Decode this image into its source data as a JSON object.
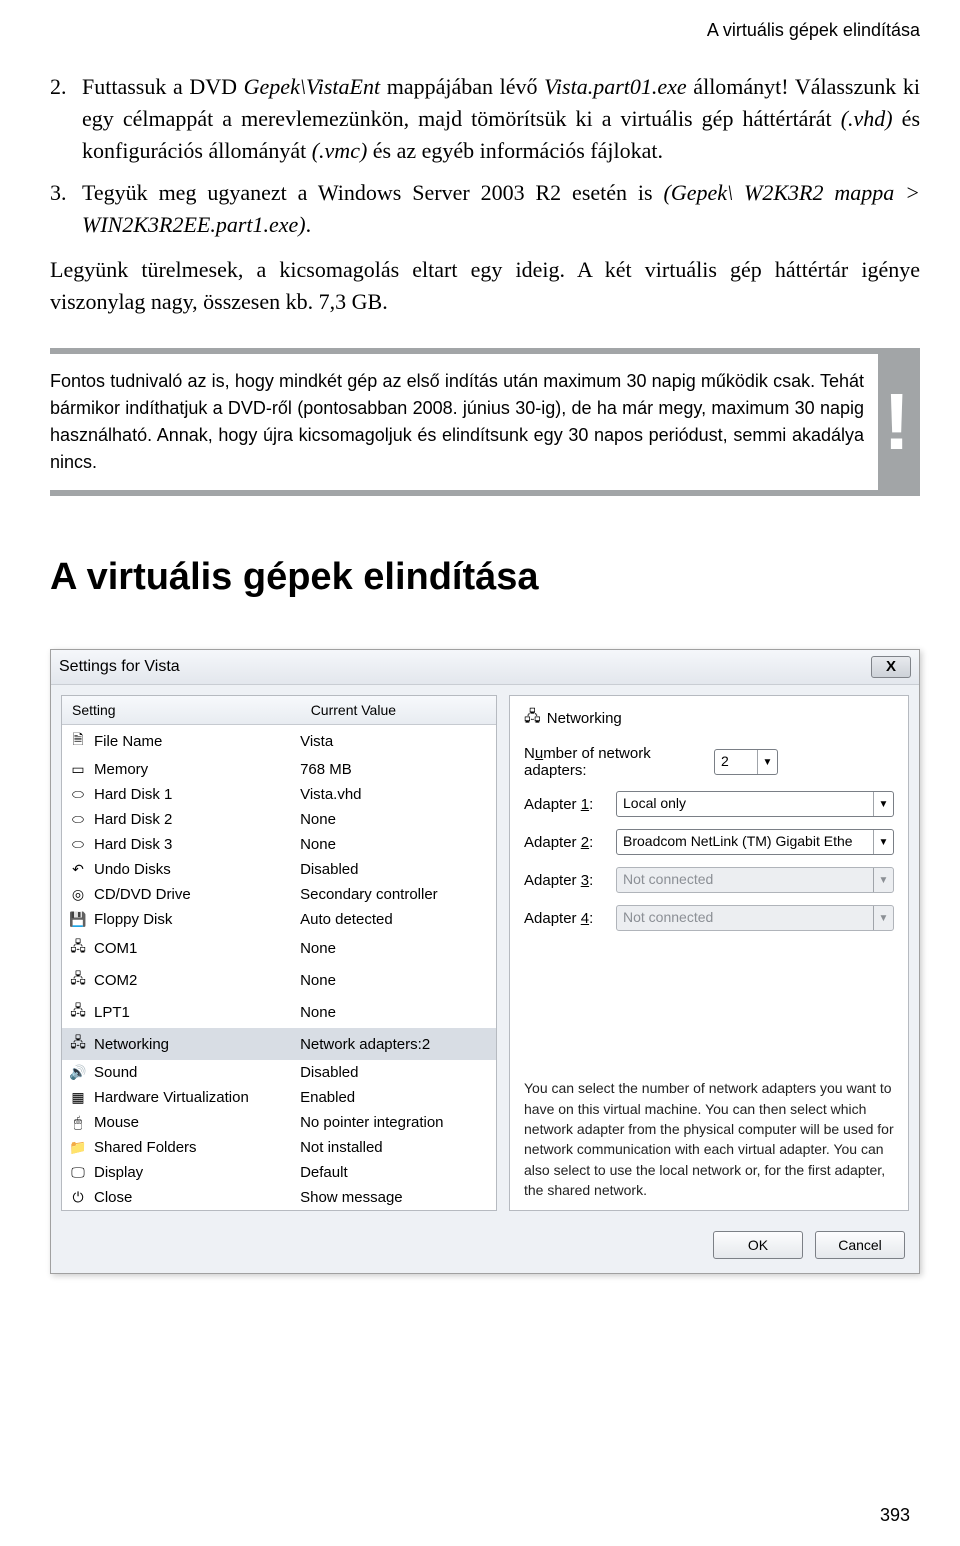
{
  "running_head": "A virtuális gépek elindítása",
  "list2": {
    "num": "2.",
    "t1": "Futtassuk a DVD ",
    "p1": "Gepek\\VistaEnt",
    "t2": " mappájában lévő ",
    "p2": "Vista.part01.exe",
    "t3": " állományt! Válasszunk ki egy célmappát a merevlemezünkön, majd tömörítsük ki a virtuális gép háttértárát ",
    "p3": "(.vhd)",
    "t4": " és konfigurációs állományát ",
    "p4": "(.vmc)",
    "t5": " és az egyéb információs fájlokat."
  },
  "list3": {
    "num": "3.",
    "t1": "Tegyük meg ugyanezt a Windows Server 2003 R2 esetén is ",
    "p1": "(Gepek\\ W2K3R2 mappa > WIN2K3R2EE.part1.exe)",
    "t2": "."
  },
  "para1": "Legyünk türelmesek, a kicsomagolás eltart egy ideig. A két virtuális gép háttértár igénye viszonylag nagy, összesen kb. 7,3 GB.",
  "note": "Fontos tudnivaló az is, hogy mindkét gép az első indítás után maximum 30 napig működik csak. Tehát bármikor indíthatjuk a DVD-ről (pontosabban 2008. június 30-ig), de ha már megy, maximum 30 napig használható. Annak, hogy újra kicsomagoljuk és elindítsunk egy 30 napos periódust, semmi akadálya nincs.",
  "note_bang": "!",
  "heading": "A virtuális gépek elindítása",
  "dialog": {
    "title": "Settings for Vista",
    "close_glyph": "X",
    "headers": {
      "setting": "Setting",
      "value": "Current Value"
    },
    "rows": [
      {
        "icon": "file-icon",
        "glyph": "🗎",
        "name": "File Name",
        "value": "Vista",
        "selected": false
      },
      {
        "icon": "memory-icon",
        "glyph": "▭",
        "name": "Memory",
        "value": "768 MB",
        "selected": false
      },
      {
        "icon": "disk-icon",
        "glyph": "⬭",
        "name": "Hard Disk 1",
        "value": "Vista.vhd",
        "selected": false
      },
      {
        "icon": "disk-icon",
        "glyph": "⬭",
        "name": "Hard Disk 2",
        "value": "None",
        "selected": false
      },
      {
        "icon": "disk-icon",
        "glyph": "⬭",
        "name": "Hard Disk 3",
        "value": "None",
        "selected": false
      },
      {
        "icon": "undo-icon",
        "glyph": "↶",
        "name": "Undo Disks",
        "value": "Disabled",
        "selected": false
      },
      {
        "icon": "cd-icon",
        "glyph": "◎",
        "name": "CD/DVD Drive",
        "value": "Secondary controller",
        "selected": false
      },
      {
        "icon": "floppy-icon",
        "glyph": "💾",
        "name": "Floppy Disk",
        "value": "Auto detected",
        "selected": false
      },
      {
        "icon": "com-icon",
        "glyph": "🖧",
        "name": "COM1",
        "value": "None",
        "selected": false
      },
      {
        "icon": "com-icon",
        "glyph": "🖧",
        "name": "COM2",
        "value": "None",
        "selected": false
      },
      {
        "icon": "lpt-icon",
        "glyph": "🖧",
        "name": "LPT1",
        "value": "None",
        "selected": false
      },
      {
        "icon": "network-icon",
        "glyph": "🖧",
        "name": "Networking",
        "value": "Network adapters:2",
        "selected": true
      },
      {
        "icon": "sound-icon",
        "glyph": "🔊",
        "name": "Sound",
        "value": "Disabled",
        "selected": false
      },
      {
        "icon": "chip-icon",
        "glyph": "▦",
        "name": "Hardware Virtualization",
        "value": "Enabled",
        "selected": false
      },
      {
        "icon": "mouse-icon",
        "glyph": "🖱",
        "name": "Mouse",
        "value": "No pointer integration",
        "selected": false
      },
      {
        "icon": "folder-icon",
        "glyph": "📁",
        "name": "Shared Folders",
        "value": "Not installed",
        "selected": false
      },
      {
        "icon": "display-icon",
        "glyph": "🖵",
        "name": "Display",
        "value": "Default",
        "selected": false
      },
      {
        "icon": "power-icon",
        "glyph": "⏻",
        "name": "Close",
        "value": "Show message",
        "selected": false
      }
    ],
    "right": {
      "title": "Networking",
      "num_label_pre": "N",
      "num_label_u": "u",
      "num_label_post": "mber of network adapters:",
      "num_value": "2",
      "adapters": [
        {
          "label": "Adapter ",
          "u": "1",
          "suffix": ":",
          "value": "Local only",
          "disabled": false
        },
        {
          "label": "Adapter ",
          "u": "2",
          "suffix": ":",
          "value": "Broadcom NetLink (TM) Gigabit Ethe",
          "disabled": false
        },
        {
          "label": "Adapter ",
          "u": "3",
          "suffix": ":",
          "value": "Not connected",
          "disabled": true
        },
        {
          "label": "Adapter ",
          "u": "4",
          "suffix": ":",
          "value": "Not connected",
          "disabled": true
        }
      ],
      "info": "You can select the number of network adapters you want to have on this virtual machine. You can then select which network adapter from the physical computer will be used for network communication with each virtual adapter. You can also select to use the local network or, for the first adapter, the shared network."
    },
    "buttons": {
      "ok": "OK",
      "cancel": "Cancel"
    }
  },
  "page_num": "393"
}
